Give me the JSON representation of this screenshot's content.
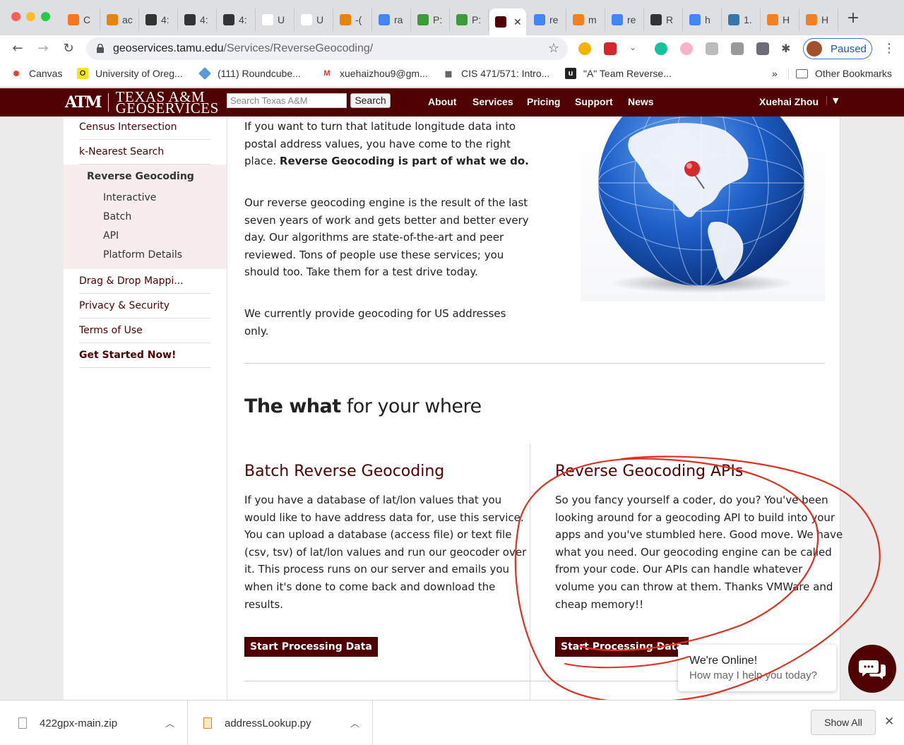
{
  "browser": {
    "tabs": [
      {
        "label": "C",
        "color": "#f4771f"
      },
      {
        "label": "ac",
        "color": "#e8830c"
      },
      {
        "label": "4:",
        "color": "#333333"
      },
      {
        "label": "4:",
        "color": "#333333"
      },
      {
        "label": "4:",
        "color": "#333333"
      },
      {
        "label": "U",
        "color": "#ffffff"
      },
      {
        "label": "U",
        "color": "#ffffff"
      },
      {
        "label": "-(",
        "color": "#e8830c"
      },
      {
        "label": "ra",
        "color": "#4285f4"
      },
      {
        "label": "P:",
        "color": "#3b9b3b"
      },
      {
        "label": "P:",
        "color": "#3b9b3b"
      },
      {
        "label": "",
        "color": "#500000"
      },
      {
        "label": "re",
        "color": "#4285f4"
      },
      {
        "label": "m",
        "color": "#f48024"
      },
      {
        "label": "re",
        "color": "#4285f4"
      },
      {
        "label": "R",
        "color": "#333333"
      },
      {
        "label": "h",
        "color": "#4285f4"
      },
      {
        "label": "1.",
        "color": "#3776ab"
      },
      {
        "label": "H",
        "color": "#f48024"
      },
      {
        "label": "H",
        "color": "#f48024"
      }
    ],
    "url_host": "geoservices.tamu.edu",
    "url_path": "/Services/ReverseGeocoding/",
    "profile_label": "Paused",
    "bookmarks": [
      {
        "label": "Canvas"
      },
      {
        "label": "University of Oreg..."
      },
      {
        "label": "(111) Roundcube..."
      },
      {
        "label": "xuehaizhou9@gm..."
      },
      {
        "label": "CIS 471/571: Intro..."
      },
      {
        "label": "\"A\" Team Reverse..."
      }
    ],
    "bookmarks_more": "»",
    "other_bookmarks": "Other Bookmarks"
  },
  "site": {
    "logo_mark": "ATM",
    "logo_line1": "TEXAS A&M",
    "logo_line2": "GEOSERVICES",
    "search_placeholder": "Search Texas A&M",
    "search_button": "Search",
    "nav": [
      "About",
      "Services",
      "Pricing",
      "Support",
      "News"
    ],
    "user": "Xuehai Zhou"
  },
  "sidebar": {
    "census": "Census Intersection",
    "knearest": "k-Nearest Search",
    "reverse": "Reverse Geocoding",
    "subitems": [
      "Interactive",
      "Batch",
      "API",
      "Platform Details"
    ],
    "dragdrop": "Drag & Drop Mappi...",
    "privacy": "Privacy & Security",
    "terms": "Terms of Use",
    "getstarted": "Get Started Now!"
  },
  "main": {
    "intro_lines": [
      "If you want to turn that latitude longitude data into",
      "postal address values, you have come to the right"
    ],
    "intro_last": "place. ",
    "intro_bold": "Reverse Geocoding is part of what we do.",
    "engine_lines": [
      "Our reverse geocoding engine is the result of the last",
      "seven years of work and gets better and better every",
      "day. Our algorithms are state-of-the-art and peer",
      "reviewed. Tons of people use these services; you",
      "should too. Take them for a test drive today."
    ],
    "us_lines": [
      "We currently provide geocoding for US addresses",
      "only."
    ],
    "section_bold": "The what",
    "section_rest": " for your where",
    "batch_title": "Batch Reverse Geocoding",
    "batch_lines": [
      "If you have a database of lat/lon values that you",
      "would like to have address data for, use this service.",
      "You can upload a database (access file) or text file",
      "(csv, tsv) of lat/lon values and run our geocoder over",
      "it. This process runs on our server and emails you",
      "when it's done to come back and download the",
      "results."
    ],
    "batch_button": "Start Processing Data",
    "api_title": "Reverse Geocoding APIs",
    "api_lines": [
      "So you fancy yourself a coder, do you? You've been",
      "looking around for a geocoding API to build into your",
      "apps and you've stumbled here. Good move. We have",
      "what you need. Our geocoding engine can be called",
      "from your code. Our APIs can handle whatever",
      "volume you can throw at them. Thanks VMWare and",
      "cheap memory!!"
    ],
    "api_button": "Start Processing Data"
  },
  "chat": {
    "title": "We're Online!",
    "subtitle": "How may I help you today?"
  },
  "downloads": {
    "items": [
      {
        "name": "422gpx-main.zip"
      },
      {
        "name": "addressLookup.py"
      }
    ],
    "show_all": "Show All"
  },
  "colors": {
    "brand": "#500000",
    "annotation": "#e03020"
  }
}
